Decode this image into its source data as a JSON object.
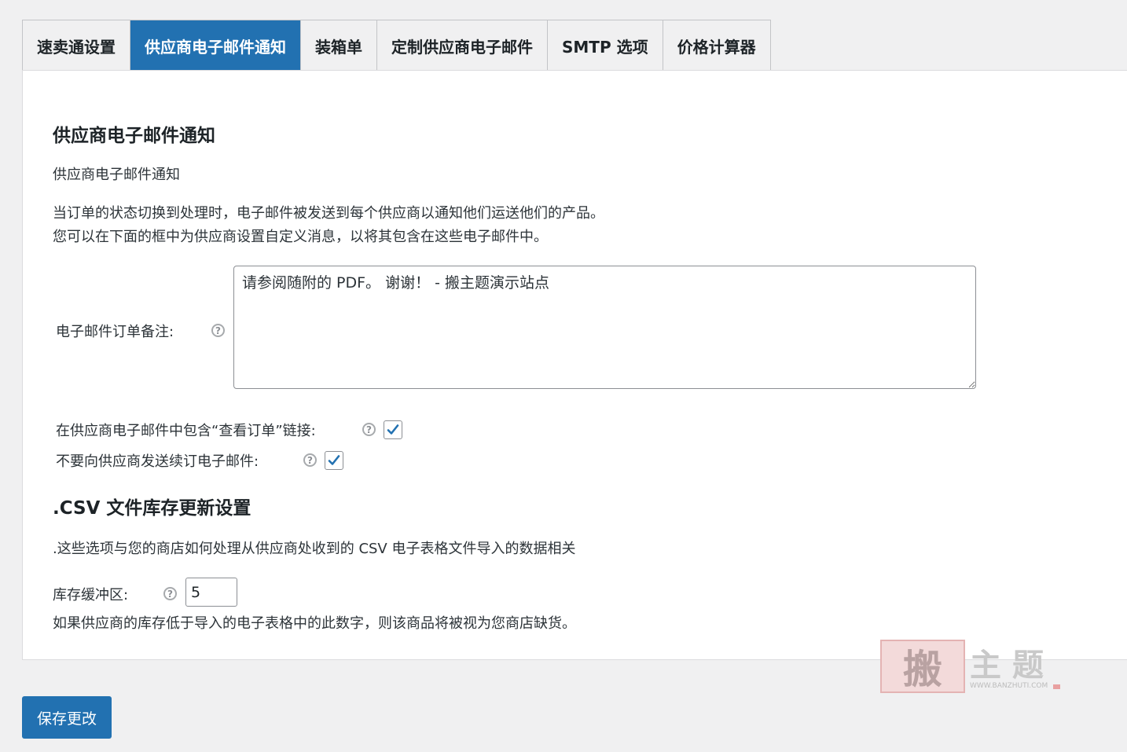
{
  "tabs": [
    {
      "label": "速卖通设置",
      "active": false
    },
    {
      "label": "供应商电子邮件通知",
      "active": true
    },
    {
      "label": "装箱单",
      "active": false
    },
    {
      "label": "定制供应商电子邮件",
      "active": false
    },
    {
      "label": "SMTP 选项",
      "active": false
    },
    {
      "label": "价格计算器",
      "active": false
    }
  ],
  "email_section": {
    "heading": "供应商电子邮件通知",
    "subtitle": "供应商电子邮件通知",
    "desc_line1": "当订单的状态切换到处理时，电子邮件被发送到每个供应商以通知他们运送他们的产品。",
    "desc_line2": "您可以在下面的框中为供应商设置自定义消息，以将其包含在这些电子邮件中。",
    "note_label": "电子邮件订单备注:",
    "note_value": "请参阅随附的 PDF。 谢谢！ - 搬主题演示站点",
    "include_link_label": "在供应商电子邮件中包含“查看订单”链接:",
    "include_link_checked": true,
    "no_renewal_label": "不要向供应商发送续订电子邮件:",
    "no_renewal_checked": true
  },
  "csv_section": {
    "heading": ".CSV 文件库存更新设置",
    "desc": ".这些选项与您的商店如何处理从供应商处收到的 CSV 电子表格文件导入的数据相关",
    "buffer_label": "库存缓冲区:",
    "buffer_value": "5",
    "buffer_help": "如果供应商的库存低于导入的电子表格中的此数字，则该商品将被视为您商店缺货。"
  },
  "save_button": "保存更改",
  "watermark": {
    "stamp": "搬",
    "text": "主题",
    "url": "WWW.BANZHUTI.COM"
  },
  "colors": {
    "accent": "#2271b1",
    "background": "#f0f0f1",
    "panel": "#ffffff"
  }
}
